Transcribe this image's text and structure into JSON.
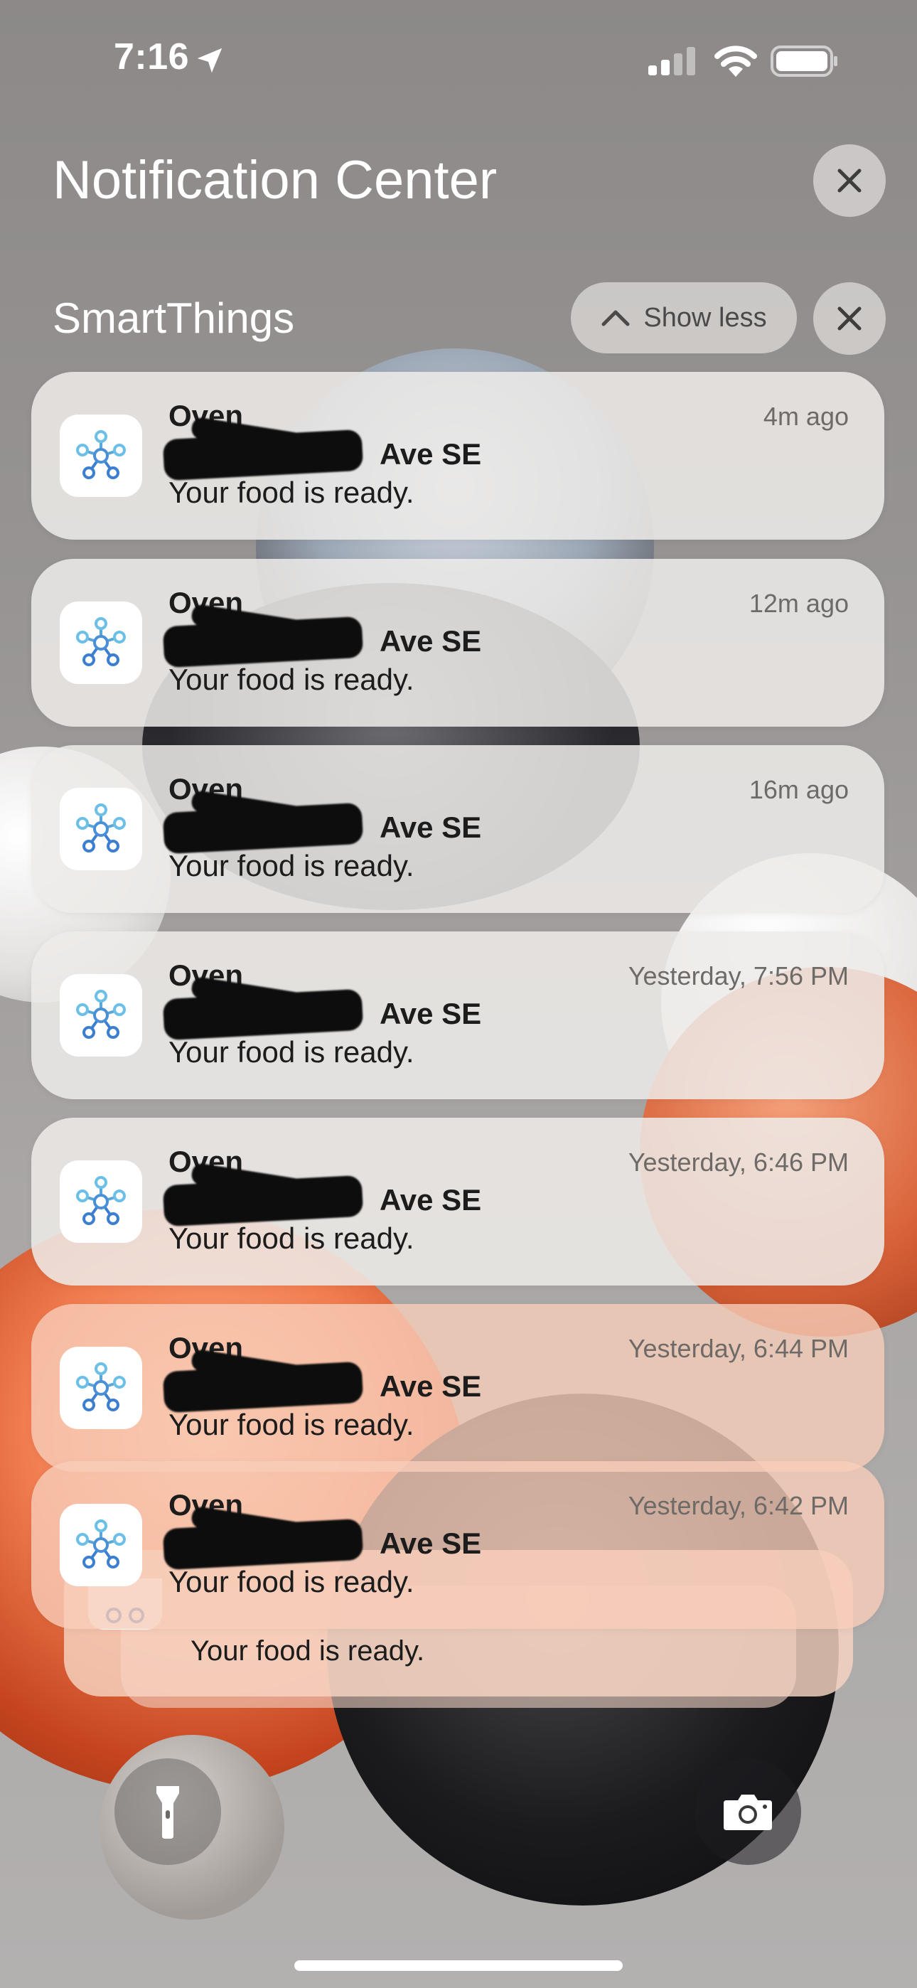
{
  "status_bar": {
    "time": "7:16",
    "icons": [
      "location-arrow-icon",
      "cellular-signal-icon",
      "wifi-icon",
      "battery-icon"
    ]
  },
  "header": {
    "title": "Notification Center",
    "close_icon": "close-icon"
  },
  "group": {
    "title": "SmartThings",
    "show_less_label": "Show less",
    "show_less_icon": "chevron-up-icon",
    "close_icon": "close-icon"
  },
  "notifications": [
    {
      "title": "Oven",
      "subtitle": "Ave SE",
      "body": "Your food is ready.",
      "time": "4m ago"
    },
    {
      "title": "Oven",
      "subtitle": "Ave SE",
      "body": "Your food is ready.",
      "time": "12m ago"
    },
    {
      "title": "Oven",
      "subtitle": "Ave SE",
      "body": "Your food is ready.",
      "time": "16m ago"
    },
    {
      "title": "Oven",
      "subtitle": "Ave SE",
      "body": "Your food is ready.",
      "time": "Yesterday, 7:56 PM"
    },
    {
      "title": "Oven",
      "subtitle": "Ave SE",
      "body": "Your food is ready.",
      "time": "Yesterday, 6:46 PM"
    },
    {
      "title": "Oven",
      "subtitle": "Ave SE",
      "body": "Your food is ready.",
      "time": "Yesterday, 6:44 PM"
    },
    {
      "title": "Oven",
      "subtitle": "Ave SE",
      "body": "Your food is ready.",
      "time": "Yesterday, 6:42 PM"
    }
  ],
  "stacked_notification": {
    "body": "Your food is ready."
  },
  "app_icon": "smartthings-icon",
  "bottom_controls": {
    "flashlight_icon": "flashlight-icon",
    "camera_icon": "camera-icon"
  }
}
